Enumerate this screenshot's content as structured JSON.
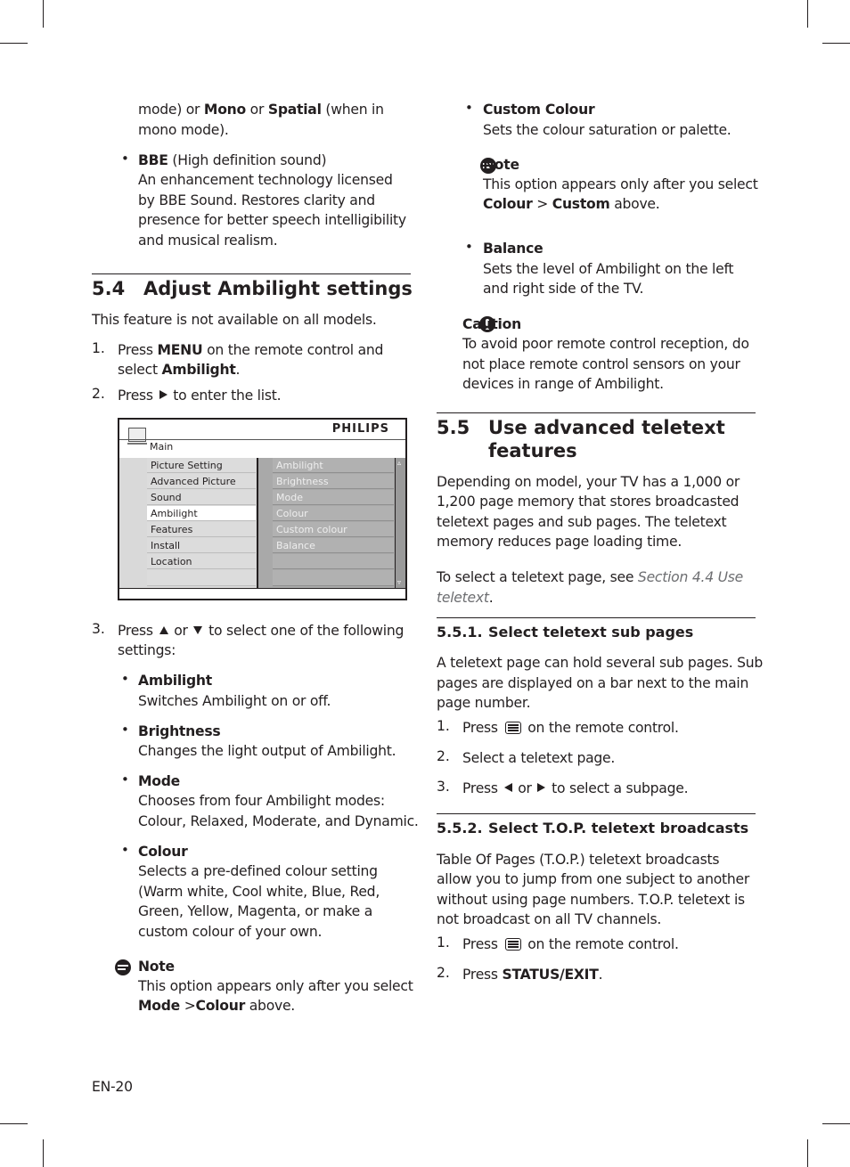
{
  "left": {
    "intro_line1_pre": "mode) or ",
    "intro_mono": "Mono",
    "intro_or": " or ",
    "intro_spatial": "Spatial",
    "intro_line1_post": " (when in",
    "intro_line2": "mono mode).",
    "bbe_title": "BBE",
    "bbe_subtitle": " (High definition sound)",
    "bbe_lines": [
      "An enhancement technology licensed",
      "by BBE Sound. Restores clarity and",
      "presence for better speech intelligibility",
      "and musical realism."
    ],
    "section": {
      "number": "5.4",
      "title": "Adjust Ambilight settings",
      "intro": "This feature is not available on all models.",
      "step1_num": "1.",
      "step1_pre": "Press ",
      "step1_menu": "MENU",
      "step1_post": " on the remote control and",
      "step1_line2_pre": "select ",
      "step1_ambilight": "Ambilight",
      "step1_line2_post": ".",
      "step2_num": "2.",
      "step2_pre": "Press ",
      "step2_post": " to enter the list.",
      "step3_num": "3.",
      "step3_pre": "Press ",
      "step3_or": " or ",
      "step3_post": " to select one of the following",
      "step3_line2": "settings:"
    },
    "settings": [
      {
        "title": "Ambilight",
        "lines": [
          "Switches Ambilight on or off."
        ]
      },
      {
        "title": "Brightness",
        "lines": [
          "Changes the light output of Ambilight."
        ]
      },
      {
        "title": "Mode",
        "lines": [
          "Chooses from four Ambilight modes:",
          "Colour, Relaxed, Moderate, and Dynamic."
        ]
      },
      {
        "title": "Colour",
        "lines": [
          "Selects a pre-defined colour setting",
          "(Warm white, Cool white, Blue, Red,",
          "Green, Yellow, Magenta, or make a",
          "custom colour of your own."
        ]
      }
    ],
    "note": {
      "title": "Note",
      "line1": "This option appears only after you select",
      "line2_mode": "Mode",
      "line2_sep": " >",
      "line2_colour": "Colour",
      "line2_post": " above."
    },
    "page_number": "EN-20"
  },
  "tv_menu": {
    "brand": "PHILIPS",
    "breadcrumb": "Main",
    "left_items": [
      "Picture Setting",
      "Advanced Picture",
      "Sound",
      "Ambilight",
      "Features",
      "Install",
      "Location",
      ""
    ],
    "selected_left": "Ambilight",
    "right_items": [
      "Ambilight",
      "Brightness",
      "Mode",
      "Colour",
      "Custom colour",
      "Balance",
      "",
      ""
    ],
    "scroll_up": "▵",
    "scroll_down": "▿"
  },
  "right": {
    "custom_colour": {
      "title": "Custom Colour",
      "line": "Sets the colour saturation or palette."
    },
    "note": {
      "title": "Note",
      "line1": "This option appears only after you select",
      "line2_colour": "Colour",
      "line2_sep": " > ",
      "line2_custom": "Custom",
      "line2_post": " above."
    },
    "balance": {
      "title": "Balance",
      "lines": [
        "Sets the level of Ambilight on the left",
        "and right side of the TV."
      ]
    },
    "caution": {
      "title": "Caution",
      "lines": [
        "To avoid poor remote control reception, do",
        "not place remote control sensors on your",
        "devices in range of Ambilight."
      ]
    },
    "section": {
      "number": "5.5",
      "title_line1": "Use advanced teletext",
      "title_line2": "features",
      "para_lines": [
        "Depending on model, your TV has a 1,000 or",
        "1,200 page memory that stores broadcasted",
        "teletext pages and sub pages. The teletext",
        "memory reduces page loading time."
      ],
      "see_pre": "To select a teletext page, see ",
      "see_link1": "Section 4.4 Use",
      "see_link2": "teletext",
      "see_post": "."
    },
    "sub1": {
      "number": "5.5.1.",
      "title": "Select teletext sub pages",
      "para_lines": [
        "A teletext page can hold several sub pages. Sub",
        "pages are displayed on a bar next to the main",
        "page number."
      ],
      "step1_num": "1.",
      "step1_pre": "Press ",
      "step1_post": " on the remote control.",
      "step2_num": "2.",
      "step2": "Select a teletext page.",
      "step3_num": "3.",
      "step3_pre": "Press ",
      "step3_or": " or ",
      "step3_post": " to select a subpage."
    },
    "sub2": {
      "number": "5.5.2.",
      "title": "Select T.O.P. teletext broadcasts",
      "para_lines": [
        "Table Of Pages (T.O.P.) teletext broadcasts",
        "allow you to jump from one subject to another",
        "without using page numbers. T.O.P. teletext is",
        "not broadcast on all TV channels."
      ],
      "step1_num": "1.",
      "step1_pre": "Press ",
      "step1_post": " on the remote control.",
      "step2_num": "2.",
      "step2_pre": "Press ",
      "step2_bold": "STATUS/EXIT",
      "step2_post": "."
    }
  }
}
